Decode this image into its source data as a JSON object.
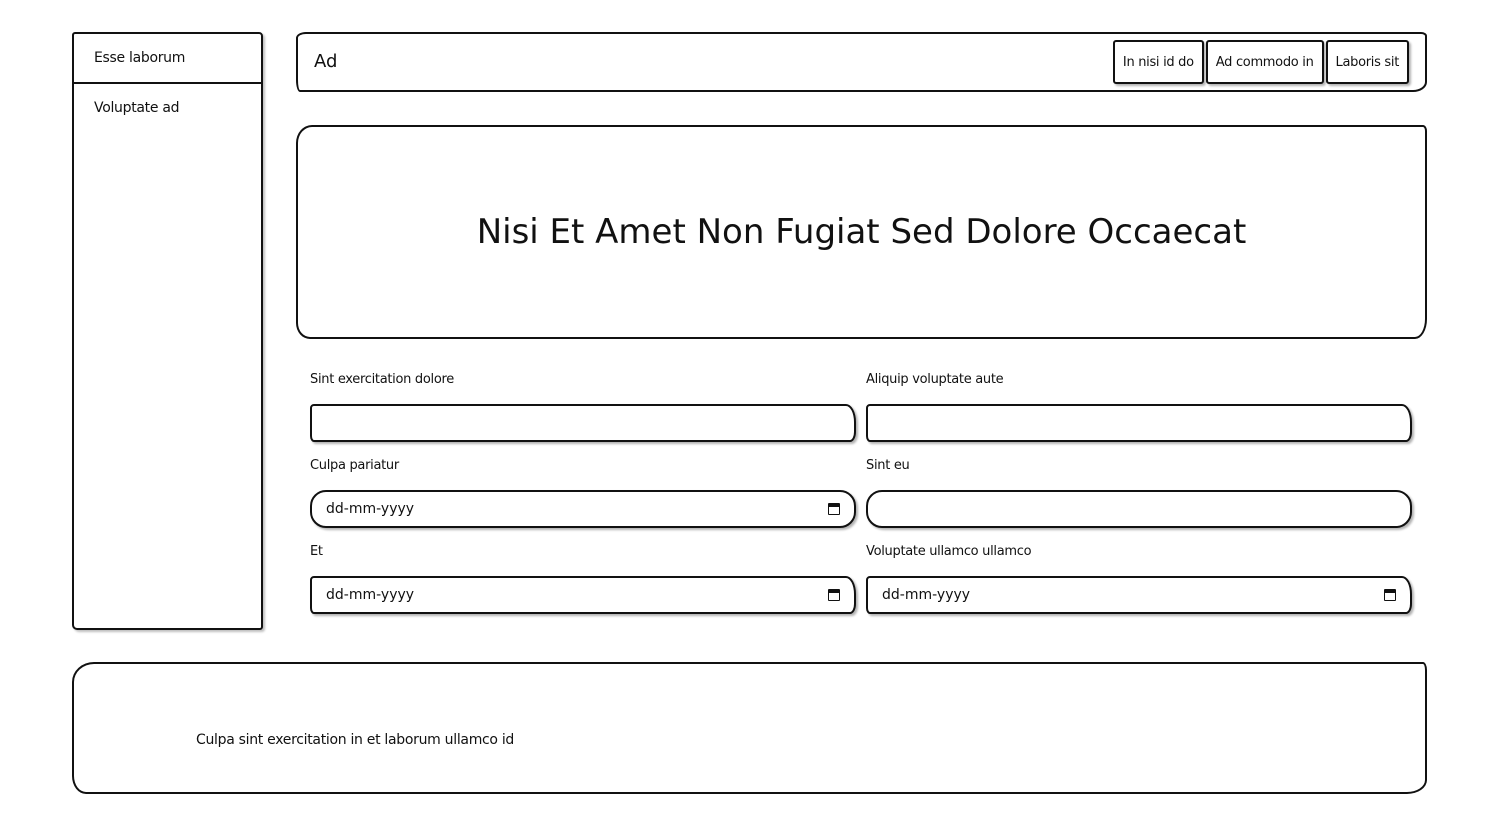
{
  "sidebar": {
    "items": [
      {
        "label": "Esse laborum"
      },
      {
        "label": "Voluptate ad"
      }
    ]
  },
  "header": {
    "title": "Ad",
    "buttons": [
      {
        "label": "In nisi id do"
      },
      {
        "label": "Ad commodo in"
      },
      {
        "label": "Laboris sit"
      }
    ]
  },
  "hero": {
    "title": "Nisi Et Amet Non Fugiat Sed Dolore Occaecat"
  },
  "form": {
    "fields": [
      {
        "label": "Sint exercitation dolore",
        "type": "text",
        "value": ""
      },
      {
        "label": "Aliquip voluptate aute",
        "type": "text",
        "value": ""
      },
      {
        "label": "Culpa pariatur",
        "type": "date",
        "placeholder": "dd-mm-yyyy"
      },
      {
        "label": "Sint eu",
        "type": "text",
        "value": ""
      },
      {
        "label": "Et",
        "type": "date",
        "placeholder": "dd-mm-yyyy"
      },
      {
        "label": "Voluptate ullamco ullamco",
        "type": "date",
        "placeholder": "dd-mm-yyyy"
      }
    ]
  },
  "footer": {
    "text": "Culpa sint exercitation in et laborum ullamco id"
  },
  "icons": {
    "date_picker": "calendar-icon"
  }
}
